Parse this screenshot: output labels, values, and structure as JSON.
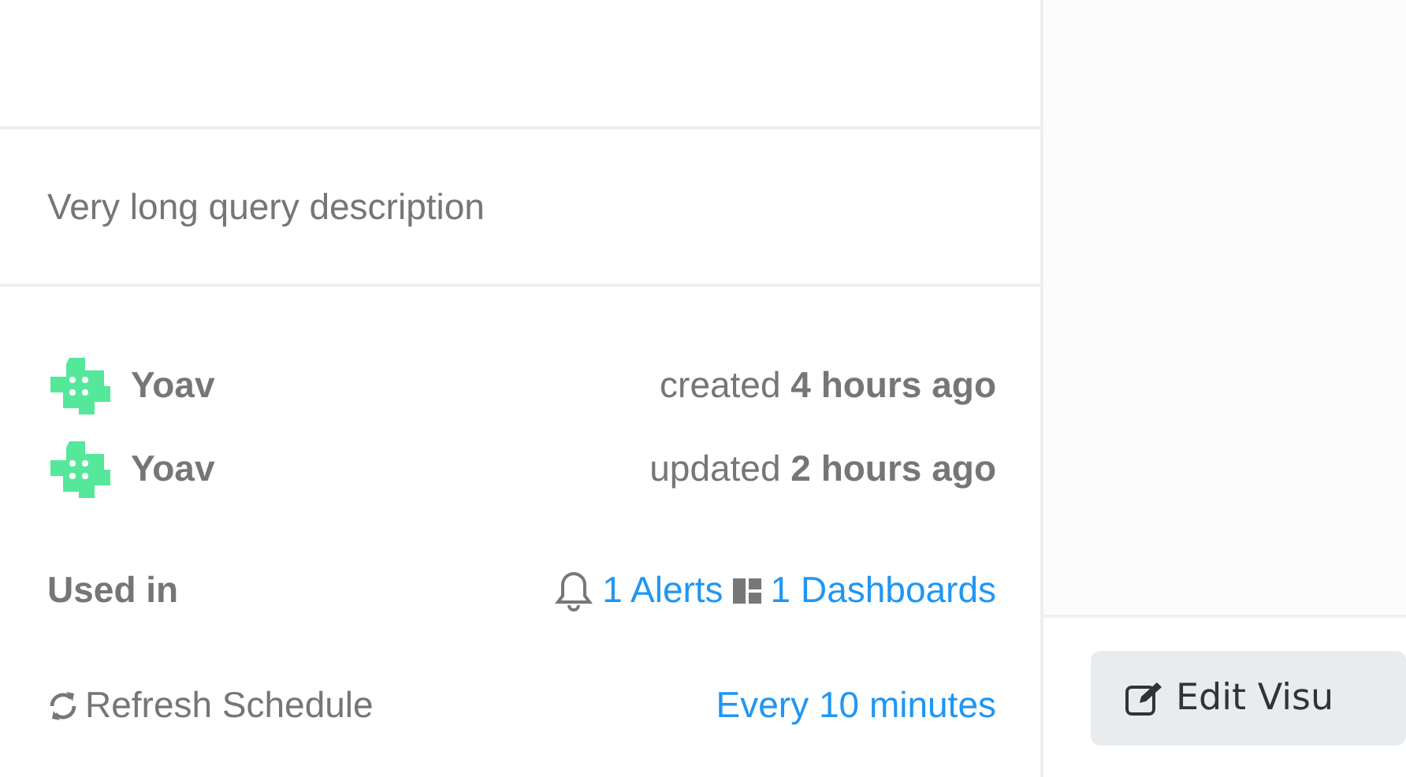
{
  "description": "Very long query description",
  "history": [
    {
      "user": "Yoav",
      "action": "created",
      "time": "4 hours ago"
    },
    {
      "user": "Yoav",
      "action": "updated",
      "time": "2 hours ago"
    }
  ],
  "used_in": {
    "label": "Used in",
    "alerts": "1 Alerts",
    "dashboards": "1 Dashboards"
  },
  "refresh": {
    "label": "Refresh Schedule",
    "value": "Every 10 minutes"
  },
  "edit_button": {
    "label": "Edit Visu"
  }
}
